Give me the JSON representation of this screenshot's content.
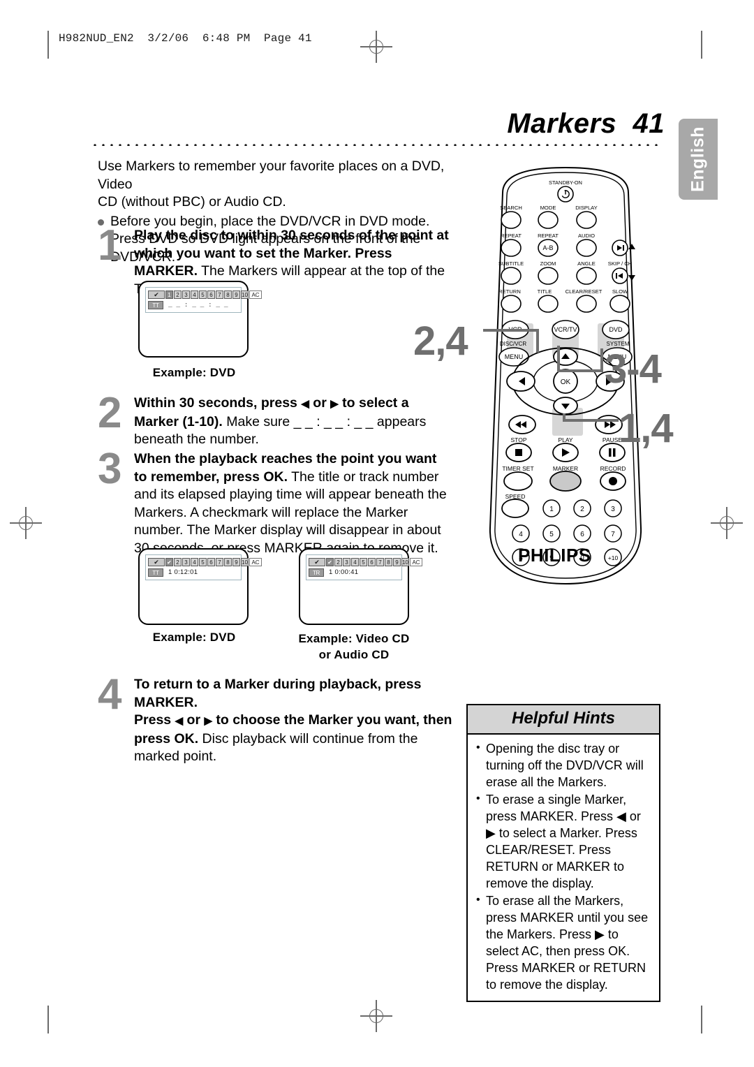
{
  "page": {
    "print_header": "H982NUD_EN2  3/2/06  6:48 PM  Page 41",
    "title": "Markers  41",
    "language_tab": "English"
  },
  "intro": {
    "line1": "Use Markers to remember your favorite places on a DVD, Video",
    "line2": "CD (without PBC) or Audio CD.",
    "bullet": "Before you begin, place the DVD/VCR in DVD mode. Press DVD so DVD light appears on the front of the DVD/VCR."
  },
  "steps": [
    {
      "number": "1",
      "bold": "Play the disc to within 30 seconds of the point at which you want to set the Marker. Press MARKER.",
      "rest": "The Markers will appear at the top of the TV screen."
    },
    {
      "number": "2",
      "bold_a": "Within 30 seconds, press ",
      "bold_b": " or ",
      "bold_c": " to select a Marker (1-10).",
      "rest": " Make sure _ _ : _ _ : _ _  appears beneath the number."
    },
    {
      "number": "3",
      "bold": "When the playback reaches the point you want to remember, press OK.",
      "rest": " The title or track number and its elapsed playing time will appear beneath the Markers. A checkmark will replace the Marker number. The Marker display will disappear in about 30 seconds, or press MARKER again to remove it."
    },
    {
      "number": "4",
      "bold_1": "To return to a Marker during playback, press MARKER.",
      "bold_2a": "Press ",
      "bold_2b": " or ",
      "bold_2c": " to choose the Marker you want, then press OK.",
      "rest": " Disc playback will continue from the marked point."
    }
  ],
  "osd": {
    "check_glyph": "✔",
    "markers_blank": [
      "1",
      "2",
      "3",
      "4",
      "5",
      "6",
      "7",
      "8",
      "9",
      "10",
      "AC"
    ],
    "markers_set": [
      "✔",
      "2",
      "3",
      "4",
      "5",
      "6",
      "7",
      "8",
      "9",
      "10",
      "AC"
    ],
    "screen1": {
      "tag": "TT",
      "time": "_ _ : _ _ : _ _"
    },
    "screen2": {
      "tag": "TT",
      "time": "1  0:12:01"
    },
    "screen3": {
      "tag": "TR",
      "time": "1    0:00:41"
    }
  },
  "captions": {
    "example_dvd_1": "Example: DVD",
    "example_dvd_2": "Example: DVD",
    "example_videocd_line1": "Example: Video CD",
    "example_videocd_line2": "or Audio CD"
  },
  "callouts": {
    "arrows": "2,4",
    "ok": "3-4",
    "marker": "1,4"
  },
  "remote": {
    "brand": "PHILIPS",
    "standby": "STANDBY-ON",
    "row1": [
      "SEARCH",
      "MODE",
      "DISPLAY"
    ],
    "row2": [
      "REPEAT",
      "REPEAT",
      "AUDIO"
    ],
    "row2_ab": "A-B",
    "row3": [
      "SUBTITLE",
      "ZOOM",
      "ANGLE"
    ],
    "skip_ch": "SKIP / CH",
    "row4": [
      "RETURN",
      "TITLE",
      "CLEAR/RESET",
      "SLOW"
    ],
    "mode_buttons": [
      "VCR",
      "VCR/TV",
      "DVD"
    ],
    "menu_left_label": "DISC/VCR",
    "menu_right_label": "SYSTEM",
    "menu_text": "MENU",
    "ok_text": "OK",
    "transport": [
      "STOP",
      "PLAY",
      "PAUSE"
    ],
    "row_timer": [
      "TIMER SET",
      "MARKER",
      "RECORD"
    ],
    "speed": "SPEED",
    "numpad": [
      "1",
      "2",
      "3",
      "4",
      "5",
      "6",
      "7",
      "8",
      "9",
      "0",
      "+10"
    ]
  },
  "hints": {
    "title": "Helpful Hints",
    "items": [
      "Opening the disc tray or turning off the DVD/VCR will erase all the Markers.",
      "To erase a single Marker, press MARKER. Press ◀ or ▶ to select a Marker. Press CLEAR/RESET. Press RETURN or MARKER to remove the display.",
      "To erase all the Markers, press MARKER until you see the Markers. Press ▶ to select AC, then press OK. Press MARKER or RETURN to remove the display."
    ]
  },
  "colors": {
    "gray_number": "#8a8a8a",
    "callout_gray": "#6f6f6f",
    "tab_gray": "#a8a8a8",
    "hint_header_gray": "#d4d4d4"
  }
}
